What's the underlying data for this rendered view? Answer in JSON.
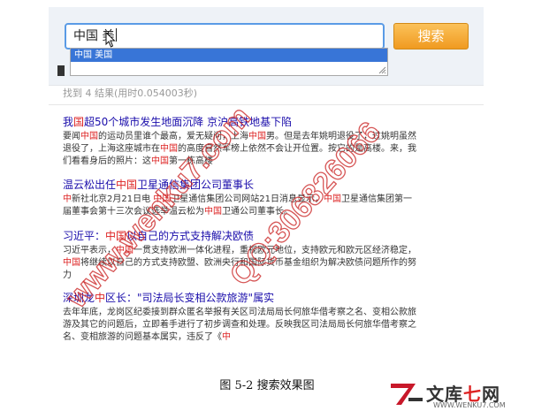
{
  "search": {
    "query": "中国 美",
    "button_label": "搜索",
    "suggestion": "中国 美国"
  },
  "results_summary": "找到 4 结果(用时0.054003秒)",
  "results": [
    {
      "title": [
        "我",
        "国",
        "超50个城市发生地面沉降 京沪高铁地基下陷"
      ],
      "snippet": [
        "要闻",
        "中国",
        "的运动员里谁个最高，爱无疑问，上海",
        "中国",
        "男。但是去年姚明退役了，过姚明虽然退役了，上海这座城市在",
        "中国",
        "的高度自然军榜上依然不会让开位置。按它的是高楼。来，我们看看身后的照片：这",
        "中国",
        "第一栋高楼"
      ]
    },
    {
      "title": [
        "温云松出任",
        "中国",
        "卫星通信集团公司董事长"
      ],
      "snippet": [
        "中",
        "新社北京2月21日电 ",
        "中国",
        "卫星通信集团公司网站21日消息显示，",
        "中国",
        "卫星通信集团第一届董事会第十三次会议选举温云松为",
        "中国",
        "卫通公司董事长。"
      ]
    },
    {
      "title": [
        "习近平：",
        "中国",
        "以自己的方式支持解决欧债"
      ],
      "snippet": [
        "习近平表示，",
        "中国",
        "一贯支持欧洲一体化进程，重视欧元地位，支持欧元和欧元区经济稳定，",
        "中国",
        "将继续以自己的方式支持欧盟、欧洲央行和国际货币基金组织为解决欧债问题所作的努力"
      ]
    },
    {
      "title": [
        "深圳龙",
        "中",
        "区长：\"司法局长变相公款旅游\"属实"
      ],
      "snippet": [
        "去年年底，龙岗区纪委接到群众匿名举报有关区司法局局长何旅华借考察之名、变相公款旅游及其它的问题后，立即着手进行了初步调查和处理。反映我区司法局局长何旅华借考察之名、变相旅游的问题基本属实，违反了《",
        "中"
      ]
    }
  ],
  "caption": "图 5-2 搜索效果图",
  "watermark": {
    "url": "www.wenku7.com",
    "qq": "QQ:306826066"
  },
  "site_logo": {
    "name_part1": "文库",
    "name_part2": "七",
    "name_part3": "网",
    "url": "WWW.WENKU7.COM"
  }
}
